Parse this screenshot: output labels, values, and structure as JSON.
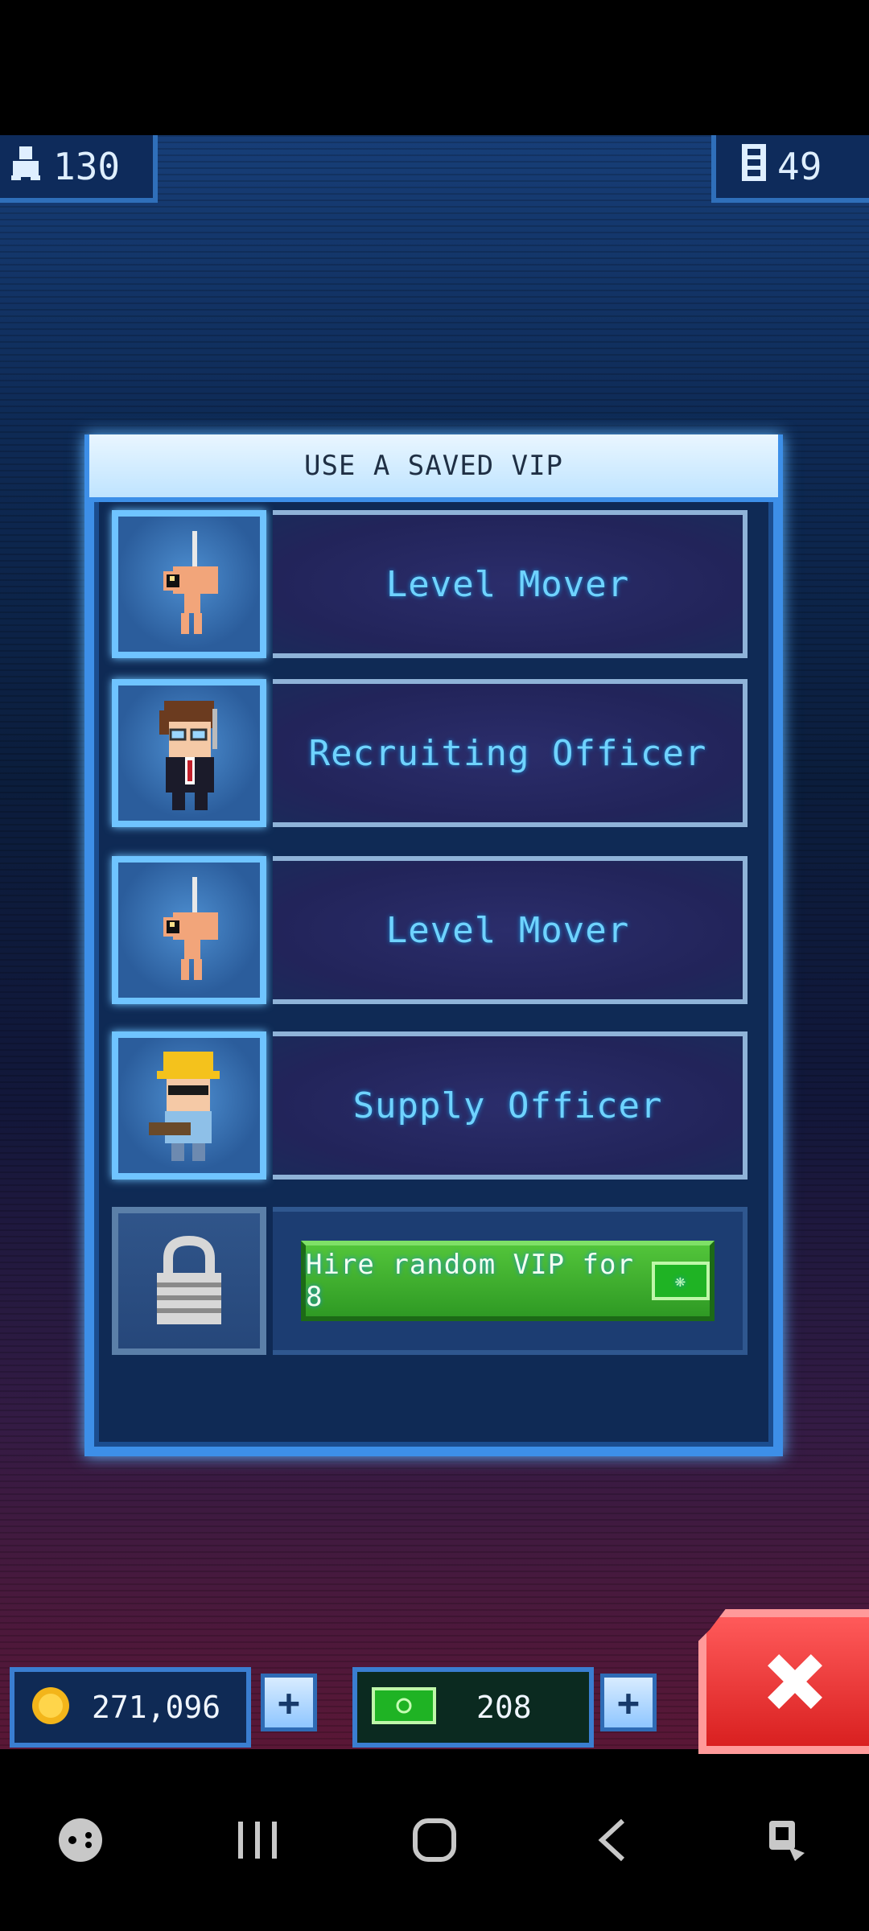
{
  "top_bar": {
    "population": "130",
    "floors": "49"
  },
  "dialog": {
    "title": "USE A SAVED VIP",
    "vips": [
      {
        "name": "Level Mover",
        "icon": "level-mover-portrait"
      },
      {
        "name": "Recruiting Officer",
        "icon": "recruiting-officer-portrait"
      },
      {
        "name": "Level Mover",
        "icon": "level-mover-portrait"
      },
      {
        "name": "Supply Officer",
        "icon": "supply-officer-portrait"
      }
    ],
    "hire_label": "Hire random VIP for 8",
    "bux_icon": "tower-bux-icon",
    "lock_icon": "padlock-icon"
  },
  "bottom_bar": {
    "coins": "271,096",
    "bux": "208"
  },
  "colors": {
    "accent": "#3d8fe8",
    "vip_name": "#6fd3ff",
    "hire_button": "#3fae2c",
    "close_button": "#e02828"
  }
}
